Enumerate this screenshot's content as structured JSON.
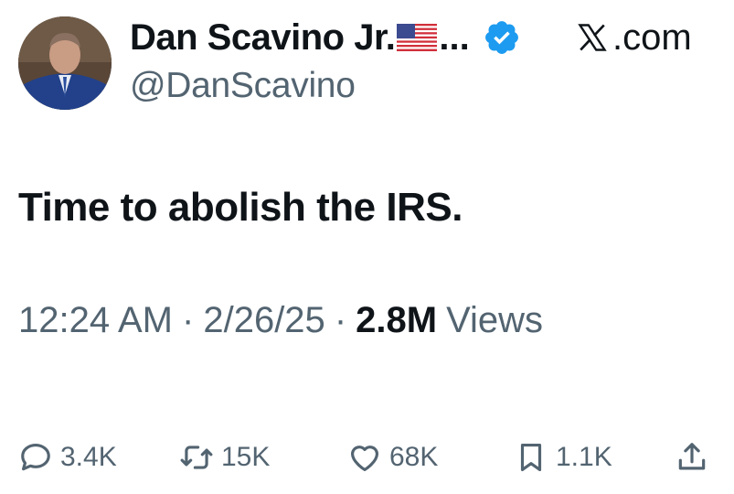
{
  "author": {
    "display_name": "Dan Scavino Jr.",
    "truncation": "...",
    "handle": "@DanScavino",
    "flag_icon": "us-flag-icon",
    "verified_icon": "verified-badge-icon",
    "verified_color": "#1d9bf0"
  },
  "brand": {
    "label": ".com",
    "logo_icon": "x-logo-icon"
  },
  "tweet": {
    "text": "Time to abolish the IRS."
  },
  "meta": {
    "time": "12:24 AM",
    "separator": "·",
    "date": "2/26/25",
    "views_count": "2.8M",
    "views_label": "Views"
  },
  "actions": {
    "replies": "3.4K",
    "reposts": "15K",
    "likes": "68K",
    "bookmarks": "1.1K"
  },
  "colors": {
    "text": "#0f1419",
    "secondary": "#536471"
  }
}
